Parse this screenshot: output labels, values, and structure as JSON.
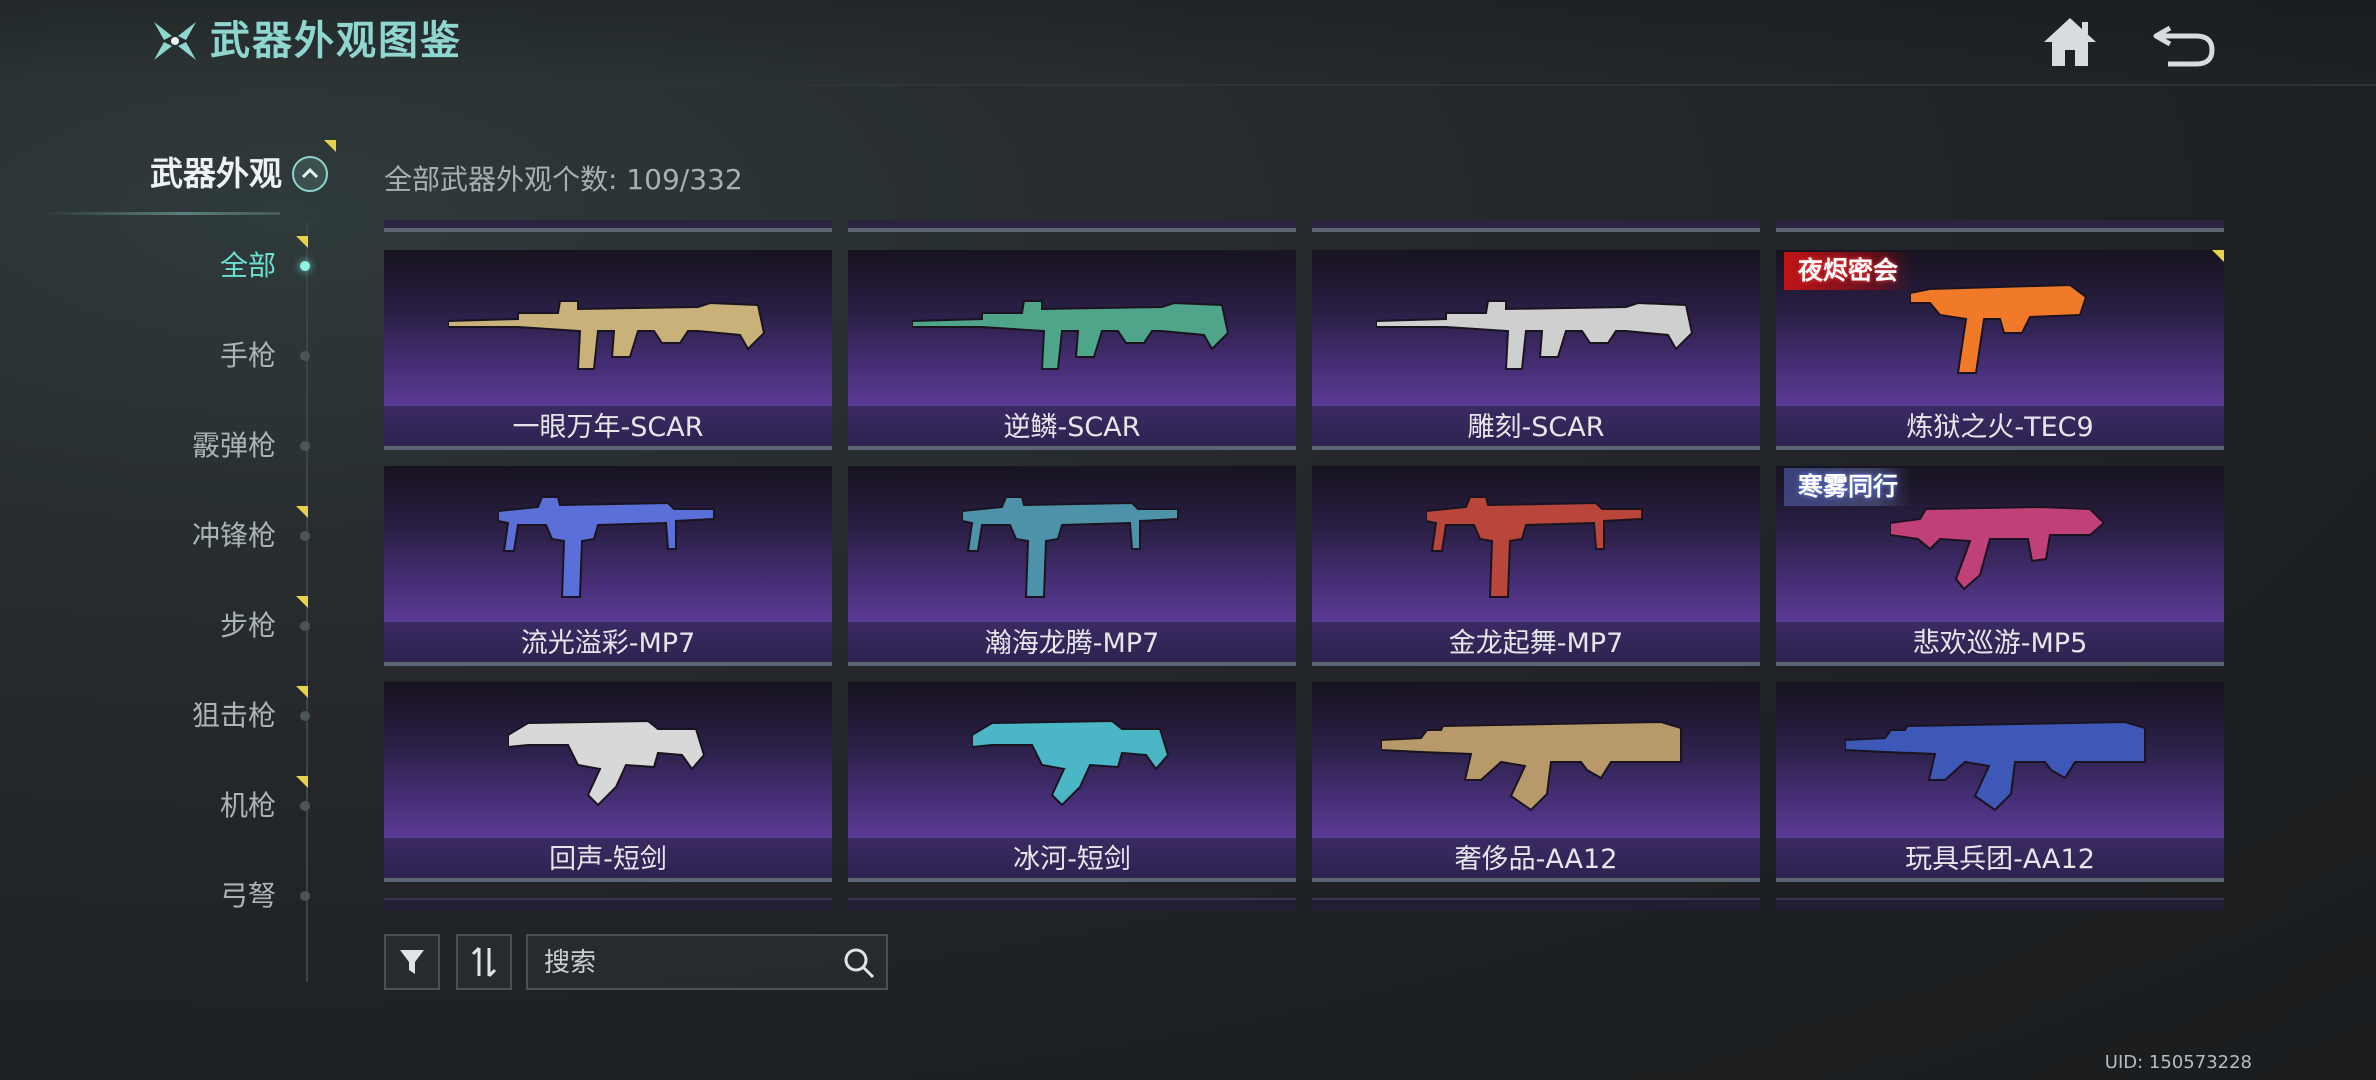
{
  "header": {
    "title": "武器外观图鉴",
    "home_icon": "home-icon",
    "back_icon": "back-arrow-icon"
  },
  "sidebar": {
    "section_title": "武器外观",
    "items": [
      {
        "label": "全部",
        "active": true,
        "flag": true
      },
      {
        "label": "手枪",
        "active": false,
        "flag": false
      },
      {
        "label": "霰弹枪",
        "active": false,
        "flag": false
      },
      {
        "label": "冲锋枪",
        "active": false,
        "flag": true
      },
      {
        "label": "步枪",
        "active": false,
        "flag": true
      },
      {
        "label": "狙击枪",
        "active": false,
        "flag": true
      },
      {
        "label": "机枪",
        "active": false,
        "flag": true
      },
      {
        "label": "弓弩",
        "active": false,
        "flag": false
      }
    ]
  },
  "main": {
    "count_text": "全部武器外观个数: 109/332",
    "cards": [
      {
        "name": "一眼万年-SCAR",
        "icon": "scar-rifle-icon",
        "accent": "#c8b27a"
      },
      {
        "name": "逆鳞-SCAR",
        "icon": "scar-rifle-icon",
        "accent": "#4fa58a"
      },
      {
        "name": "雕刻-SCAR",
        "icon": "scar-rifle-icon",
        "accent": "#cfcfcf"
      },
      {
        "name": "炼狱之火-TEC9",
        "icon": "tec9-pistol-icon",
        "accent": "#f07a28",
        "badge": "夜烬密会",
        "badge_style": "red",
        "flag": true
      },
      {
        "name": "流光溢彩-MP7",
        "icon": "mp7-smg-icon",
        "accent": "#5a6fd8"
      },
      {
        "name": "瀚海龙腾-MP7",
        "icon": "mp7-smg-icon",
        "accent": "#4d92a8"
      },
      {
        "name": "金龙起舞-MP7",
        "icon": "mp7-smg-icon",
        "accent": "#b8463a"
      },
      {
        "name": "悲欢巡游-MP5",
        "icon": "mp5-smg-icon",
        "accent": "#c04078",
        "badge": "寒雾同行",
        "badge_style": "ice"
      },
      {
        "name": "回声-短剑",
        "icon": "vector-smg-icon",
        "accent": "#d8d8d8"
      },
      {
        "name": "冰河-短剑",
        "icon": "vector-smg-icon",
        "accent": "#4bb6c6"
      },
      {
        "name": "奢侈品-AA12",
        "icon": "aa12-shotgun-icon",
        "accent": "#b89a6a"
      },
      {
        "name": "玩具兵团-AA12",
        "icon": "aa12-shotgun-icon",
        "accent": "#3e58b8"
      }
    ]
  },
  "controls": {
    "filter_icon": "filter-icon",
    "sort_icon": "sort-icon",
    "search_placeholder": "搜索",
    "search_icon": "search-icon"
  },
  "footer": {
    "uid": "UID: 150573228"
  },
  "colors": {
    "accent": "#8fd6cf",
    "active_nav": "#6ee0d2",
    "card_bg": "#5b3a98",
    "flag": "#e8d24a"
  }
}
